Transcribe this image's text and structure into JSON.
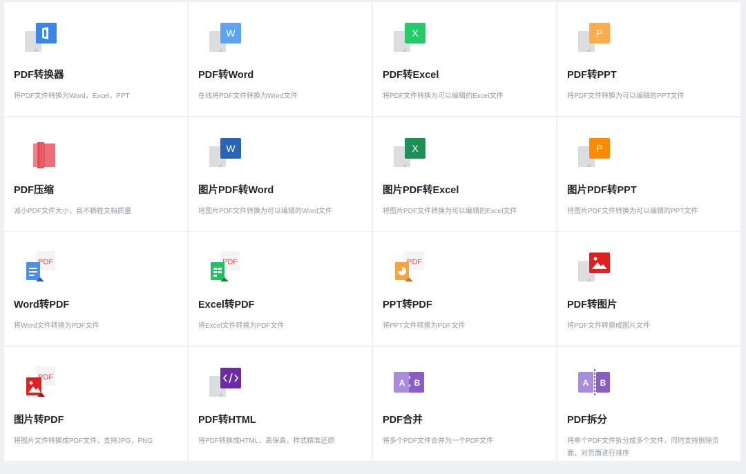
{
  "tools": [
    {
      "title": "PDF转换器",
      "desc": "将PDF文件转换为Word，Excel，PPT",
      "icon": "office-icon",
      "color": "#3a86e8"
    },
    {
      "title": "PDF转Word",
      "desc": "在线将PDF文件转换为Word文件",
      "icon": "word-icon",
      "color": "#5aa3f5",
      "letter": "W"
    },
    {
      "title": "PDF转Excel",
      "desc": "将PDF文件转换为可以编辑的Excel文件",
      "icon": "excel-icon",
      "color": "#23cc66",
      "letter": "X"
    },
    {
      "title": "PDF转PPT",
      "desc": "将PDF文件转换为可以编辑的PPT文件",
      "icon": "ppt-icon",
      "color": "#ffab4a",
      "letter": "P"
    },
    {
      "title": "PDF压缩",
      "desc": "减小PDF文件大小，且不牺牲文档质量",
      "icon": "compress-icon",
      "color": "#ea5560"
    },
    {
      "title": "图片PDF转Word",
      "desc": "将图片PDF文件转换为可以编辑的Word文件",
      "icon": "word-icon",
      "color": "#2864b8",
      "letter": "W"
    },
    {
      "title": "图片PDF转Excel",
      "desc": "将图片PDF文件转换为可以编辑的Excel文件",
      "icon": "excel-icon",
      "color": "#1d8f57",
      "letter": "X"
    },
    {
      "title": "图片PDF转PPT",
      "desc": "将图片PDF文件转换为可以编辑的PPT文件",
      "icon": "ppt-icon",
      "color": "#ff8a00",
      "letter": "P"
    },
    {
      "title": "Word转PDF",
      "desc": "将Word文件转换为PDF文件",
      "icon": "doc-to-pdf-icon",
      "color": "#4a8ef0",
      "badge": "PDF"
    },
    {
      "title": "Excel转PDF",
      "desc": "将Excel文件转换为PDF文件",
      "icon": "sheet-to-pdf-icon",
      "color": "#23c05f",
      "badge": "PDF"
    },
    {
      "title": "PPT转PDF",
      "desc": "将PPT文件转换为PDF文件",
      "icon": "slides-to-pdf-icon",
      "color": "#f8a43b",
      "badge": "PDF"
    },
    {
      "title": "PDF转图片",
      "desc": "将PDF文件转换成图片文件",
      "icon": "image-icon",
      "color": "#e02020"
    },
    {
      "title": "图片转PDF",
      "desc": "将图片文件转换成PDF文件，支持JPG，PNG",
      "icon": "image-to-pdf-icon",
      "color": "#e02020",
      "badge": "PDF"
    },
    {
      "title": "PDF转HTML",
      "desc": "将PDF转换成HTML，高保真，样式精准还原",
      "icon": "code-icon",
      "color": "#6c2aa8"
    },
    {
      "title": "PDF合并",
      "desc": "将多个PDF文件合并为一个PDF文件",
      "icon": "merge-icon",
      "color": "#8a5cc8",
      "a": "A",
      "b": "B"
    },
    {
      "title": "PDF拆分",
      "desc": "将单个PDF文件拆分成多个文件，同时支持删除页面，对页面进行排序",
      "icon": "split-icon",
      "color": "#8a5cc8",
      "a": "A",
      "b": "B"
    }
  ]
}
